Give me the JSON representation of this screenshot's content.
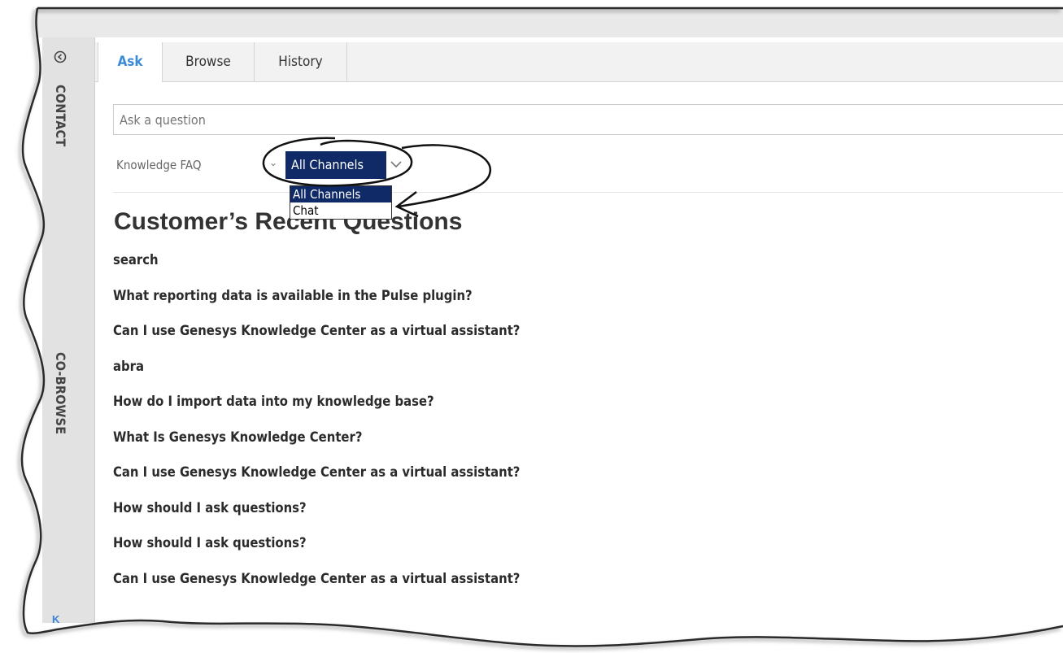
{
  "sidebar": {
    "contact_label": "CONTACT",
    "cobrowse_label": "CO-BROWSE",
    "bottom_badge": "K"
  },
  "tabs": [
    {
      "label": "Ask",
      "active": true
    },
    {
      "label": "Browse",
      "active": false
    },
    {
      "label": "History",
      "active": false
    }
  ],
  "search": {
    "placeholder": "Ask a question",
    "value": ""
  },
  "filter": {
    "knowledge_base_label": "Knowledge FAQ",
    "channel_selected": "All Channels",
    "channel_options": [
      "All Channels",
      "Chat"
    ]
  },
  "recent": {
    "heading": "Customer’s Recent Questions",
    "questions": [
      "search",
      "What reporting data is available in the Pulse plugin?",
      "Can I use Genesys Knowledge Center as a virtual assistant?",
      "abra",
      "How do I import data into my knowledge base?",
      "What Is Genesys Knowledge Center?",
      "Can I use Genesys Knowledge Center as a virtual assistant?",
      "How should I ask questions?",
      "How should I ask questions?",
      "Can I use Genesys Knowledge Center as a virtual assistant?"
    ]
  },
  "colors": {
    "active_tab": "#3b8ad8",
    "select_bg": "#0f2a66",
    "heading_text": "#333333"
  },
  "icons": {
    "collapse": "circle-chevron-left-icon",
    "select": "chevron-down-icon"
  }
}
